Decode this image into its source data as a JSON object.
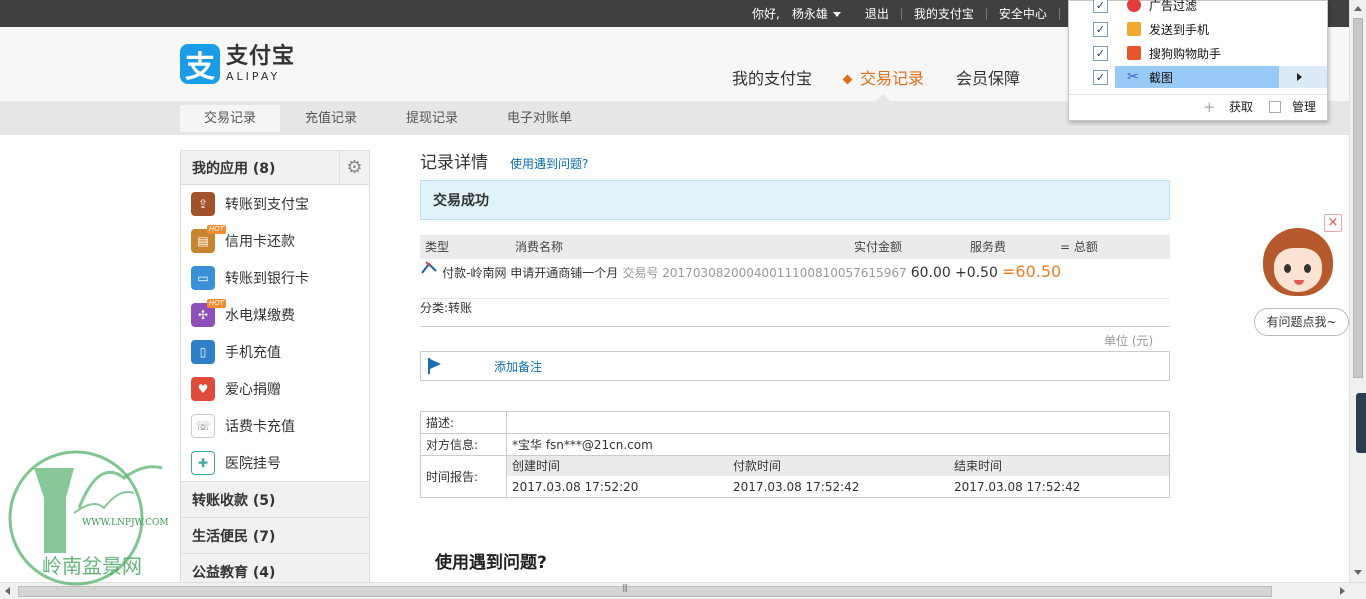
{
  "topbar": {
    "greeting": "你好,",
    "username": "杨永雄",
    "logout": "退出",
    "my_alipay": "我的支付宝",
    "security_center": "安全中心"
  },
  "logo": {
    "cn": "支付宝",
    "en": "ALIPAY",
    "mark": "支"
  },
  "mainnav": {
    "items": [
      {
        "label": "我的支付宝"
      },
      {
        "label": "交易记录"
      },
      {
        "label": "会员保障"
      }
    ],
    "active_index": 1
  },
  "subnav": {
    "tabs": [
      {
        "label": "交易记录"
      },
      {
        "label": "充值记录"
      },
      {
        "label": "提现记录"
      },
      {
        "label": "电子对账单"
      }
    ]
  },
  "sidebar": {
    "header": "我的应用 (8)",
    "gear_icon": "gear-icon",
    "apps": [
      {
        "label": "转账到支付宝",
        "icon": "transfer-icon",
        "color": "#a0522d",
        "hot": false
      },
      {
        "label": "信用卡还款",
        "icon": "credit-card-icon",
        "color": "#c9842f",
        "hot": true
      },
      {
        "label": "转账到银行卡",
        "icon": "bank-card-icon",
        "color": "#3a8fd9",
        "hot": false
      },
      {
        "label": "水电煤缴费",
        "icon": "utilities-icon",
        "color": "#8e4fb7",
        "hot": true
      },
      {
        "label": "手机充值",
        "icon": "phone-icon",
        "color": "#2f7fc9",
        "hot": false
      },
      {
        "label": "爱心捐赠",
        "icon": "heart-icon",
        "color": "#e04a3a",
        "hot": false
      },
      {
        "label": "话费卡充值",
        "icon": "phone-card-icon",
        "color": "#8a8a8a",
        "hot": false
      },
      {
        "label": "医院挂号",
        "icon": "hospital-icon",
        "color": "#3aa7a0",
        "hot": false
      }
    ],
    "hot_badge": "HOT",
    "groups": [
      {
        "label": "转账收款 (5)"
      },
      {
        "label": "生活便民 (7)"
      },
      {
        "label": "公益教育 (4)"
      }
    ]
  },
  "record": {
    "title": "记录详情",
    "help_link": "使用遇到问题?",
    "status": "交易成功",
    "columns": [
      "类型",
      "消费名称",
      "实付金额",
      "服务费",
      "= 总额"
    ],
    "item_name": "付款-岭南网 申请开通商铺一个月",
    "trade_no_label": "交易号",
    "trade_no": "2017030820004001110081005761596​7",
    "paid": "60.00",
    "fee": "+0.50",
    "total": "=60.50",
    "category": "分类:转账",
    "unit": "单位 (元)",
    "add_note": "添加备注"
  },
  "details": {
    "desc_label": "描述:",
    "desc_value": "",
    "party_label": "对方信息:",
    "party_value": "*宝华 fsn***@21cn.com",
    "time_label": "时间报告:",
    "time_headers": [
      "创建时间",
      "付款时间",
      "结束时间"
    ],
    "time_values": [
      "2017.03.08 17:52:20",
      "2017.03.08 17:52:42",
      "2017.03.08 17:52:42"
    ]
  },
  "faq_title": "使用遇到问题?",
  "popup_menu": {
    "items": [
      {
        "label": "广告过滤",
        "checked": true,
        "icon": "ad-filter-icon",
        "color": "#e23c3c"
      },
      {
        "label": "发送到手机",
        "checked": true,
        "icon": "send-phone-icon",
        "color": "#f0a830"
      },
      {
        "label": "搜狗购物助手",
        "checked": true,
        "icon": "shopping-icon",
        "color": "#e8552a"
      },
      {
        "label": "截图",
        "checked": true,
        "icon": "scissors-icon",
        "color": "#3f5fbf"
      }
    ],
    "get": "获取",
    "manage": "管理"
  },
  "helper": {
    "bubble": "有问题点我~",
    "close": "×"
  },
  "watermark": {
    "url": "WWW.LNPJW.COM",
    "name": "岭南盆景网"
  },
  "colors": {
    "accent": "#e16f18",
    "link": "#0b6fb1",
    "brand": "#1a9ce6",
    "status_bg": "#e1f3fa"
  }
}
